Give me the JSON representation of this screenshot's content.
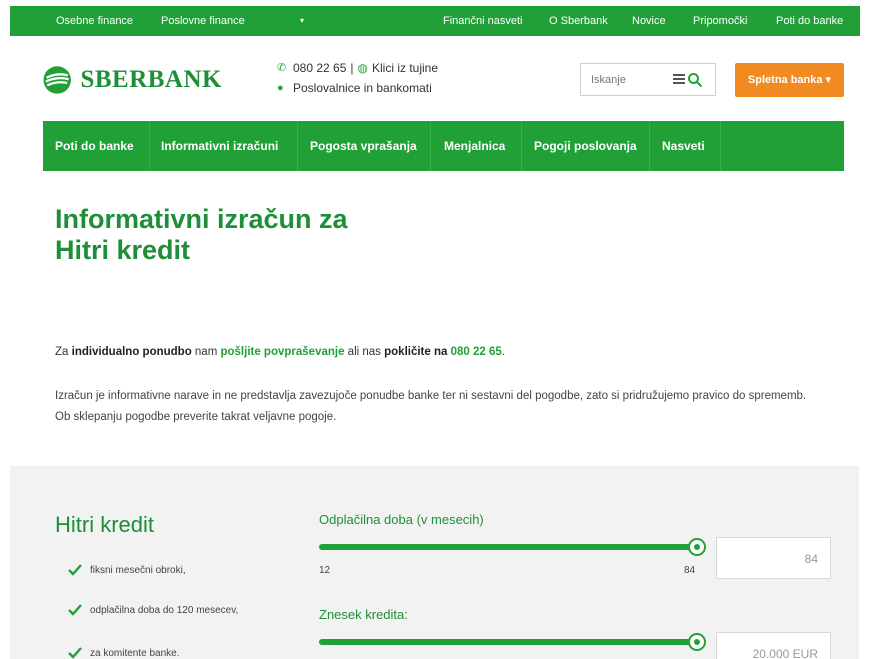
{
  "topbar": {
    "left_items": [
      "Osebne finance",
      "Poslovne finance"
    ],
    "dropdown_caret": "▾",
    "right_items": [
      "Finančni nasveti",
      "O Sberbank",
      "Novice",
      "Pripomočki",
      "Poti do banke"
    ]
  },
  "header": {
    "logo_text": "SBERBANK",
    "phone": "080 22 65",
    "separator": "|",
    "abroad_label": "Klici iz tujine",
    "branches_label": "Poslovalnice in bankomati",
    "search_placeholder": "Iskanje",
    "ebank_label": "Spletna banka ▾"
  },
  "mainnav": {
    "tabs": [
      "Poti do banke",
      "Informativni izračuni",
      "Pogosta vprašanja",
      "Menjalnica",
      "Pogoji poslovanja",
      "Nasveti"
    ]
  },
  "content": {
    "title_line1": "Informativni izračun za",
    "title_line2": "Hitri kredit",
    "lead": {
      "p1": "Za ",
      "b1": "individualno ponudbo",
      "p2": " nam ",
      "link": "pošljite povpraševanje",
      "p3": " ali nas ",
      "b2": "pokličite na",
      "p4": " ",
      "phone": "080 22 65",
      "p5": "."
    },
    "disclaimer": "Izračun je informativne narave in ne predstavlja zavezujoče ponudbe banke ter ni sestavni del pogodbe, zato si pridružujemo pravico do sprememb. Ob sklepanju pogodbe preverite takrat veljavne pogoje."
  },
  "calculator": {
    "title": "Hitri kredit",
    "features": [
      "fiksni mesečni obroki,",
      "odplačilna doba do 120 mesecev,",
      "za komitente banke."
    ],
    "term": {
      "label": "Odplačilna doba (v mesecih)",
      "min_label": "12",
      "max_label": "84",
      "value": "84",
      "fraction": 1.0
    },
    "amount": {
      "label": "Znesek kredita:",
      "value": "20.000 EUR",
      "fraction": 1.0
    }
  },
  "colors": {
    "brand_green": "#21a038",
    "title_green": "#1e8f38",
    "accent_orange": "#f28a22",
    "band_gray": "#f2f2f2"
  }
}
